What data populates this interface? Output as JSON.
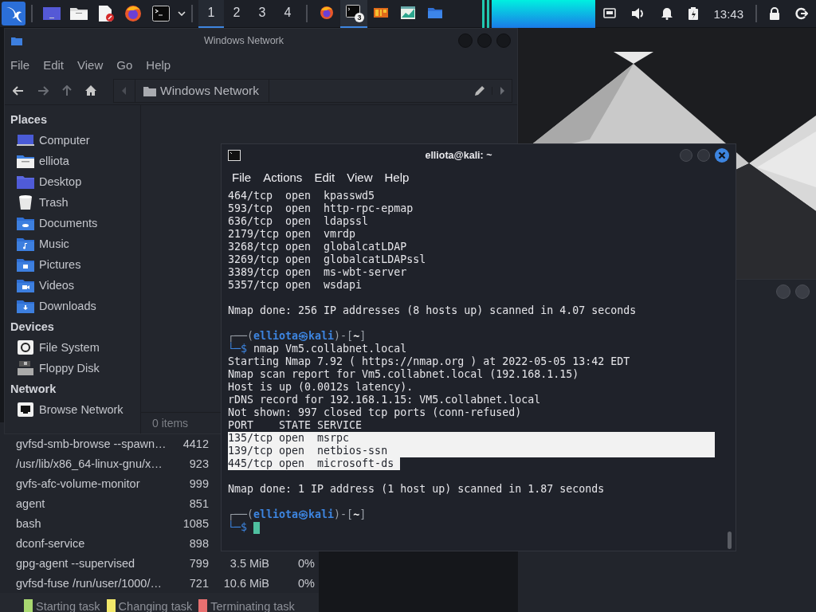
{
  "taskbar": {
    "workspaces": [
      {
        "label": "1",
        "selected": true
      },
      {
        "label": "2",
        "selected": false
      },
      {
        "label": "3",
        "selected": false
      },
      {
        "label": "4",
        "selected": false
      }
    ],
    "tasks": [
      {
        "kind": "browser",
        "selected": false
      },
      {
        "kind": "terminal",
        "selected": true,
        "badge": "3"
      },
      {
        "kind": "tool",
        "selected": false
      },
      {
        "kind": "monitor",
        "selected": false
      },
      {
        "kind": "folder",
        "selected": false
      }
    ],
    "clock": "13:43"
  },
  "file_manager": {
    "title": "Windows Network",
    "menu": [
      "File",
      "Edit",
      "View",
      "Go",
      "Help"
    ],
    "location": "Windows Network",
    "sidebar": [
      {
        "heading": "Places",
        "items": [
          {
            "label": "Computer",
            "kind": "computer"
          },
          {
            "label": "elliota",
            "kind": "home"
          },
          {
            "label": "Desktop",
            "kind": "desktop"
          },
          {
            "label": "Trash",
            "kind": "trash"
          },
          {
            "label": "Documents",
            "kind": "documents"
          },
          {
            "label": "Music",
            "kind": "music"
          },
          {
            "label": "Pictures",
            "kind": "pictures"
          },
          {
            "label": "Videos",
            "kind": "videos"
          },
          {
            "label": "Downloads",
            "kind": "downloads"
          }
        ]
      },
      {
        "heading": "Devices",
        "items": [
          {
            "label": "File System",
            "kind": "disk"
          },
          {
            "label": "Floppy Disk",
            "kind": "floppy"
          }
        ]
      },
      {
        "heading": "Network",
        "items": [
          {
            "label": "Browse Network",
            "kind": "network"
          }
        ]
      }
    ],
    "status": "0 items"
  },
  "task_manager": {
    "rows": [
      {
        "name": "gvfsd-smb-browse --spawn…",
        "pid": "4412"
      },
      {
        "name": "/usr/lib/x86_64-linux-gnu/x…",
        "pid": "923"
      },
      {
        "name": "gvfs-afc-volume-monitor",
        "pid": "999"
      },
      {
        "name": "agent",
        "pid": "851"
      },
      {
        "name": "bash",
        "pid": "1085"
      },
      {
        "name": "dconf-service",
        "pid": "898"
      },
      {
        "name": "gpg-agent --supervised",
        "pid": "799",
        "memory": "3.5 MiB",
        "cpu": "0%"
      },
      {
        "name": "gvfsd-fuse /run/user/1000/…",
        "pid": "721",
        "memory": "10.6 MiB",
        "cpu": "0%"
      }
    ],
    "legend": [
      {
        "label": "Starting task",
        "color": "#a8d870"
      },
      {
        "label": "Changing task",
        "color": "#f2e86a"
      },
      {
        "label": "Terminating task",
        "color": "#e87070"
      }
    ]
  },
  "terminal": {
    "title": "elliota@kali: ~",
    "menu": [
      "File",
      "Actions",
      "Edit",
      "View",
      "Help"
    ],
    "lines": [
      {
        "kind": "output",
        "text": "464/tcp  open  kpasswd5",
        "selected": false
      },
      {
        "kind": "output",
        "text": "593/tcp  open  http-rpc-epmap",
        "selected": false
      },
      {
        "kind": "output",
        "text": "636/tcp  open  ldapssl",
        "selected": false
      },
      {
        "kind": "output",
        "text": "2179/tcp open  vmrdp",
        "selected": false
      },
      {
        "kind": "output",
        "text": "3268/tcp open  globalcatLDAP",
        "selected": false
      },
      {
        "kind": "output",
        "text": "3269/tcp open  globalcatLDAPssl",
        "selected": false
      },
      {
        "kind": "output",
        "text": "3389/tcp open  ms-wbt-server",
        "selected": false
      },
      {
        "kind": "output",
        "text": "5357/tcp open  wsdapi",
        "selected": false
      },
      {
        "kind": "blank"
      },
      {
        "kind": "output",
        "text": "Nmap done: 256 IP addresses (8 hosts up) scanned in 4.07 seconds",
        "selected": false
      },
      {
        "kind": "blank"
      },
      {
        "kind": "prompt",
        "open": "┌──(",
        "user": "elliota㉿kali",
        "mid": ")-[",
        "dir": "~",
        "close": "]"
      },
      {
        "kind": "command",
        "mark": "└─$",
        "text": "nmap Vm5.collabnet.local"
      },
      {
        "kind": "output",
        "text": "Starting Nmap 7.92 ( https://nmap.org ) at 2022-05-05 13:42 EDT",
        "selected": false
      },
      {
        "kind": "output",
        "text": "Nmap scan report for Vm5.collabnet.local (192.168.1.15)",
        "selected": false
      },
      {
        "kind": "output",
        "text": "Host is up (0.0012s latency).",
        "selected": false
      },
      {
        "kind": "output",
        "text": "rDNS record for 192.168.1.15: VM5.collabnet.local",
        "selected": false
      },
      {
        "kind": "output",
        "text": "Not shown: 997 closed tcp ports (conn-refused)",
        "selected": false
      },
      {
        "kind": "output",
        "text": "PORT    STATE SERVICE",
        "selected": false
      },
      {
        "kind": "output",
        "text": "135/tcp open  msrpc",
        "selected": true
      },
      {
        "kind": "output",
        "text": "139/tcp open  netbios-ssn",
        "selected": true
      },
      {
        "kind": "output",
        "text": "445/tcp open  microsoft-ds",
        "selected": true
      },
      {
        "kind": "blank"
      },
      {
        "kind": "output",
        "text": "Nmap done: 1 IP address (1 host up) scanned in 1.87 seconds",
        "selected": false
      },
      {
        "kind": "blank"
      },
      {
        "kind": "prompt",
        "open": "┌──(",
        "user": "elliota㉿kali",
        "mid": ")-[",
        "dir": "~",
        "close": "]"
      },
      {
        "kind": "command",
        "mark": "└─$",
        "cursor": true
      }
    ]
  }
}
